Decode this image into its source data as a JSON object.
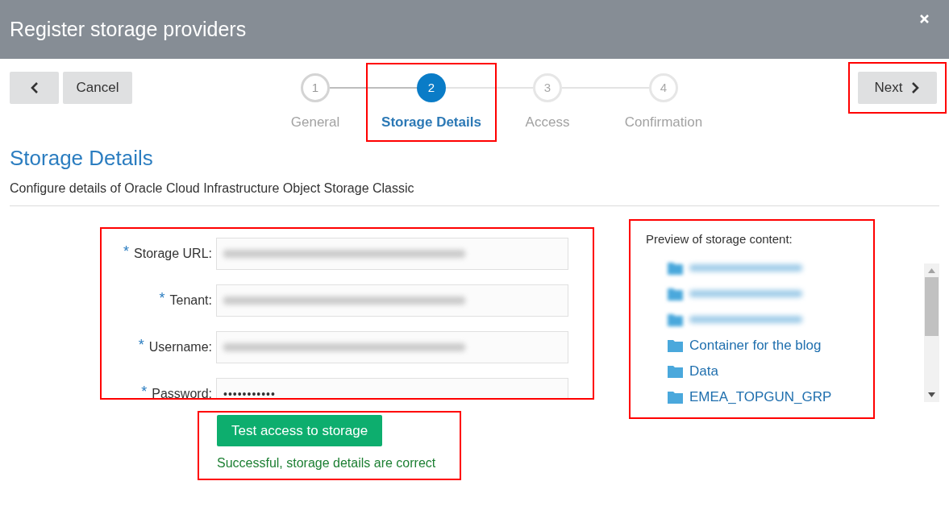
{
  "window": {
    "title": "Register storage providers"
  },
  "nav": {
    "cancel": "Cancel",
    "next": {
      "label": "Next",
      "highlighted": true
    }
  },
  "step_frame": {
    "highlighted": true
  },
  "steps": [
    {
      "number": "1",
      "label": "General",
      "selected": false,
      "done": true
    },
    {
      "number": "2",
      "label": "Storage Details",
      "selected": true,
      "done": false
    },
    {
      "number": "3",
      "label": "Access",
      "selected": false,
      "done": false
    },
    {
      "number": "4",
      "label": "Confirmation",
      "selected": false,
      "done": false
    }
  ],
  "section": {
    "title": "Storage Details",
    "subtitle": "Configure details of Oracle Cloud Infrastructure Object Storage Classic"
  },
  "form": {
    "highlighted": true,
    "fields": [
      {
        "label": "Storage URL:",
        "required_mark": "*",
        "kind": "blurred"
      },
      {
        "label": "Tenant:",
        "required_mark": "*",
        "kind": "blurred"
      },
      {
        "label": "Username:",
        "required_mark": "*",
        "kind": "blurred"
      },
      {
        "label": "Password:",
        "required_mark": "*",
        "kind": "password",
        "value": "•••••••••••"
      }
    ]
  },
  "test": {
    "highlighted": true,
    "button": "Test access to storage",
    "result": "Successful, storage details are correct"
  },
  "preview": {
    "highlighted": true,
    "title": "Preview of storage content:",
    "items": [
      {
        "blurred": true
      },
      {
        "blurred": true
      },
      {
        "blurred": true
      },
      {
        "blurred": false,
        "label": "Container for the blog"
      },
      {
        "blurred": false,
        "label": "Data"
      },
      {
        "blurred": false,
        "label": "EMEA_TOPGUN_GRP"
      }
    ]
  }
}
